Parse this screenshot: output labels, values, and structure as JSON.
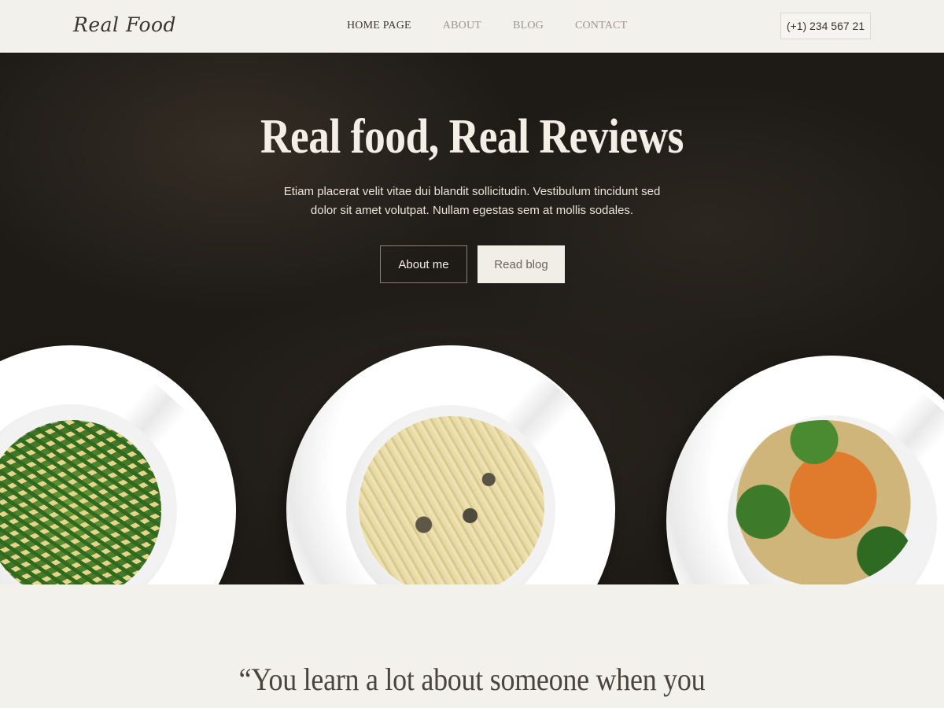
{
  "brand": {
    "logo_text": "Real Food"
  },
  "nav": {
    "items": [
      {
        "label": "HOME PAGE",
        "active": true
      },
      {
        "label": "ABOUT",
        "active": false
      },
      {
        "label": "BLOG",
        "active": false
      },
      {
        "label": "CONTACT",
        "active": false
      }
    ]
  },
  "header": {
    "phone": "(+1) 234 567 21"
  },
  "hero": {
    "title": "Real food, Real Reviews",
    "subtitle": "Etiam placerat velit vitae dui blandit sollicitudin. Vestibulum tincidunt sed dolor sit amet volutpat. Nullam egestas sem at mollis sodales.",
    "buttons": {
      "primary": "About me",
      "secondary": "Read blog"
    },
    "dishes": [
      "penne-green-beans",
      "creamy-mushroom-tagliatelle",
      "chicken-broccoli-rice"
    ]
  },
  "quote": {
    "text": "“You learn a lot about someone when you"
  },
  "colors": {
    "hero_bg": "#1e1b17",
    "page_bg": "#f3f1ec",
    "text_dark": "#3a3530"
  }
}
